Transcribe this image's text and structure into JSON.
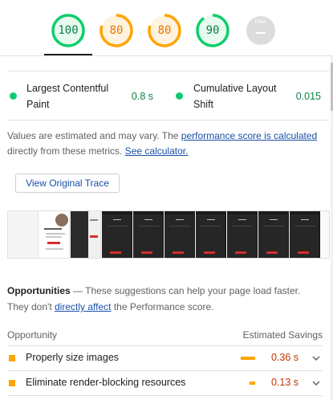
{
  "scores": [
    {
      "value": "100",
      "rating": "pass",
      "color": "#0cce6b",
      "score": 1.0
    },
    {
      "value": "80",
      "rating": "average",
      "color": "#ffa400",
      "score": 0.8
    },
    {
      "value": "80",
      "rating": "average",
      "color": "#ffa400",
      "score": 0.8
    },
    {
      "value": "90",
      "rating": "pass",
      "color": "#0cce6b",
      "score": 0.9
    },
    {
      "value": "PWA",
      "rating": "na",
      "color": "#dddddd",
      "score": 0
    }
  ],
  "metrics": [
    {
      "title": "Largest Contentful Paint",
      "value": "0.8 s",
      "color": "#0cce6b"
    },
    {
      "title": "Cumulative Layout Shift",
      "value": "0.015",
      "color": "#0cce6b"
    }
  ],
  "description": {
    "prefix": "Values are estimated and may vary. The ",
    "link1": "performance score is calculated",
    "middle": " directly from these metrics. ",
    "link2": "See calculator."
  },
  "trace_button": "View Original Trace",
  "filmstrip": {
    "frame_count": 10
  },
  "opportunities": {
    "title": "Opportunities",
    "text": " — These suggestions can help your page load faster. They don't ",
    "link": "directly affect",
    "suffix": " the Performance score.",
    "col_left": "Opportunity",
    "col_right": "Estimated Savings",
    "items": [
      {
        "label": "Properly size images",
        "value": "0.36 s",
        "savings": 0.36
      },
      {
        "label": "Eliminate render-blocking resources",
        "value": "0.13 s",
        "savings": 0.13
      }
    ]
  },
  "colors": {
    "pass": "#0cce6b",
    "average": "#ffa400",
    "link": "#1a4fa8"
  }
}
